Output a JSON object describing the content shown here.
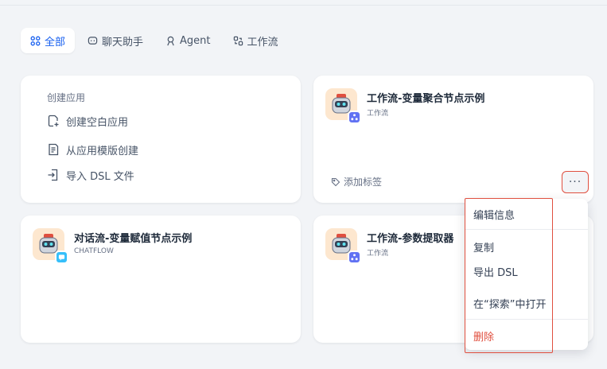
{
  "tabs": [
    {
      "label": "全部",
      "icon": "grid-icon",
      "active": true
    },
    {
      "label": "聊天助手",
      "icon": "chat-icon"
    },
    {
      "label": "Agent",
      "icon": "agent-icon"
    },
    {
      "label": "工作流",
      "icon": "workflow-icon"
    }
  ],
  "create": {
    "title": "创建应用",
    "items": [
      {
        "label": "创建空白应用",
        "icon": "file-plus-icon"
      },
      {
        "label": "从应用模版创建",
        "icon": "template-icon"
      },
      {
        "label": "导入 DSL 文件",
        "icon": "import-icon"
      }
    ]
  },
  "apps": [
    {
      "name": "工作流-变量聚合节点示例",
      "type": "工作流",
      "badge_color": "#6172f3",
      "tag_label": "添加标签"
    },
    {
      "name": "对话流-变量赋值节点示例",
      "type": "CHATFLOW",
      "badge_color": "#36bffa"
    },
    {
      "name": "工作流-参数提取器",
      "type": "工作流",
      "badge_color": "#6172f3"
    }
  ],
  "menu": {
    "items": [
      {
        "label": "编辑信息"
      },
      {
        "label": "复制"
      },
      {
        "label": "导出 DSL"
      },
      {
        "label": "在“探索”中打开"
      },
      {
        "label": "删除",
        "danger": true
      }
    ]
  },
  "colors": {
    "accent": "#155eef",
    "highlight": "#e04f3f",
    "avatar_bg": "#fde7cf"
  }
}
